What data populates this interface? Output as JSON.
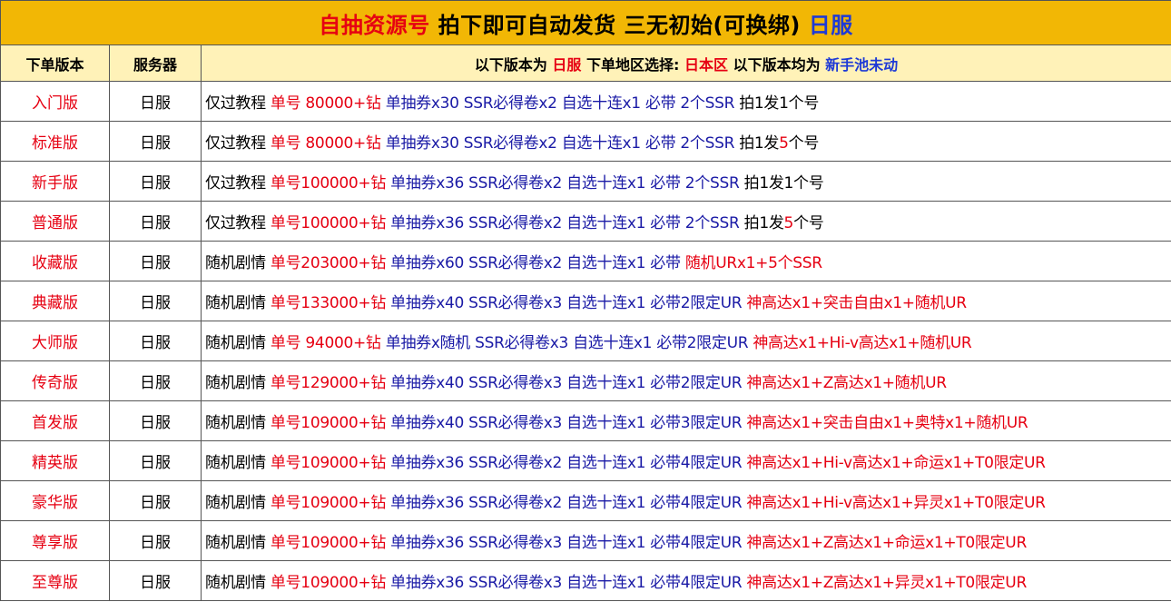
{
  "title": [
    {
      "text": "自抽资源号 ",
      "color": "r"
    },
    {
      "text": "拍下即可自动发货 三无初始(可换绑) ",
      "color": "k"
    },
    {
      "text": "日服",
      "color": "bb"
    }
  ],
  "header": {
    "col_version": "下单版本",
    "col_server": "服务器",
    "col_desc": [
      {
        "text": "以下版本为 ",
        "color": "k"
      },
      {
        "text": "日服",
        "color": "r"
      },
      {
        "text": " 下单地区选择: ",
        "color": "k"
      },
      {
        "text": "日本区",
        "color": "r"
      },
      {
        "text": " 以下版本均为 ",
        "color": "k"
      },
      {
        "text": "新手池未动",
        "color": "bb"
      }
    ]
  },
  "rows": [
    {
      "version": "入门版",
      "server": "日服",
      "desc": [
        {
          "text": "仅过教程 ",
          "color": "k"
        },
        {
          "text": "单号  80000+钻 ",
          "color": "r"
        },
        {
          "text": "单抽券x30  SSR必得卷x2  自选十连x1  必带 2个SSR ",
          "color": "b"
        },
        {
          "text": " 拍1发1个号",
          "color": "k"
        }
      ]
    },
    {
      "version": "标准版",
      "server": "日服",
      "desc": [
        {
          "text": "仅过教程 ",
          "color": "k"
        },
        {
          "text": "单号  80000+钻 ",
          "color": "r"
        },
        {
          "text": "单抽券x30  SSR必得卷x2  自选十连x1  必带 2个SSR ",
          "color": "b"
        },
        {
          "text": " 拍1发",
          "color": "k"
        },
        {
          "text": "5",
          "color": "r"
        },
        {
          "text": "个号",
          "color": "k"
        }
      ]
    },
    {
      "version": "新手版",
      "server": "日服",
      "desc": [
        {
          "text": "仅过教程 ",
          "color": "k"
        },
        {
          "text": "单号100000+钻 ",
          "color": "r"
        },
        {
          "text": "单抽券x36  SSR必得卷x2  自选十连x1  必带 2个SSR ",
          "color": "b"
        },
        {
          "text": " 拍1发1个号",
          "color": "k"
        }
      ]
    },
    {
      "version": "普通版",
      "server": "日服",
      "desc": [
        {
          "text": "仅过教程 ",
          "color": "k"
        },
        {
          "text": "单号100000+钻 ",
          "color": "r"
        },
        {
          "text": "单抽券x36  SSR必得卷x2  自选十连x1  必带 2个SSR ",
          "color": "b"
        },
        {
          "text": " 拍1发",
          "color": "k"
        },
        {
          "text": "5",
          "color": "r"
        },
        {
          "text": "个号",
          "color": "k"
        }
      ]
    },
    {
      "version": "收藏版",
      "server": "日服",
      "desc": [
        {
          "text": "随机剧情 ",
          "color": "k"
        },
        {
          "text": "单号203000+钻 ",
          "color": "r"
        },
        {
          "text": "单抽券x60  SSR必得卷x2  自选十连x1  必带 ",
          "color": "b"
        },
        {
          "text": "随机URx1+5个SSR",
          "color": "r"
        }
      ]
    },
    {
      "version": "典藏版",
      "server": "日服",
      "desc": [
        {
          "text": "随机剧情 ",
          "color": "k"
        },
        {
          "text": "单号133000+钻 ",
          "color": "r"
        },
        {
          "text": "单抽券x40  SSR必得卷x3  自选十连x1  必带2限定UR ",
          "color": "b"
        },
        {
          "text": "神高达x1+突击自由x1+随机UR",
          "color": "r"
        }
      ]
    },
    {
      "version": "大师版",
      "server": "日服",
      "desc": [
        {
          "text": "随机剧情 ",
          "color": "k"
        },
        {
          "text": "单号  94000+钻 ",
          "color": "r"
        },
        {
          "text": "单抽券x随机 SSR必得卷x3  自选十连x1  必带2限定UR ",
          "color": "b"
        },
        {
          "text": "神高达x1+Hi-v高达x1+随机UR",
          "color": "r"
        }
      ]
    },
    {
      "version": "传奇版",
      "server": "日服",
      "desc": [
        {
          "text": "随机剧情 ",
          "color": "k"
        },
        {
          "text": "单号129000+钻 ",
          "color": "r"
        },
        {
          "text": "单抽券x40 SSR必得卷x3  自选十连x1  必带2限定UR ",
          "color": "b"
        },
        {
          "text": "神高达x1+Z高达x1+随机UR",
          "color": "r"
        }
      ]
    },
    {
      "version": "首发版",
      "server": "日服",
      "desc": [
        {
          "text": "随机剧情 ",
          "color": "k"
        },
        {
          "text": "单号109000+钻 ",
          "color": "r"
        },
        {
          "text": "单抽券x40 SSR必得卷x3 自选十连x1  必带3限定UR ",
          "color": "b"
        },
        {
          "text": "神高达x1+突击自由x1+奥特x1+随机UR",
          "color": "r"
        }
      ]
    },
    {
      "version": "精英版",
      "server": "日服",
      "desc": [
        {
          "text": "随机剧情 ",
          "color": "k"
        },
        {
          "text": "单号109000+钻 ",
          "color": "r"
        },
        {
          "text": "单抽券x36 SSR必得卷x2 自选十连x1  必带4限定UR ",
          "color": "b"
        },
        {
          "text": "神高达x1+Hi-v高达x1+命运x1+T0限定UR",
          "color": "r"
        }
      ]
    },
    {
      "version": "豪华版",
      "server": "日服",
      "desc": [
        {
          "text": "随机剧情 ",
          "color": "k"
        },
        {
          "text": "单号109000+钻 ",
          "color": "r"
        },
        {
          "text": "单抽券x36 SSR必得卷x2 自选十连x1  必带4限定UR ",
          "color": "b"
        },
        {
          "text": "神高达x1+Hi-v高达x1+异灵x1+T0限定UR",
          "color": "r"
        }
      ]
    },
    {
      "version": "尊享版",
      "server": "日服",
      "desc": [
        {
          "text": "随机剧情 ",
          "color": "k"
        },
        {
          "text": "单号109000+钻 ",
          "color": "r"
        },
        {
          "text": "单抽券x36 SSR必得卷x3 自选十连x1  必带4限定UR ",
          "color": "b"
        },
        {
          "text": "神高达x1+Z高达x1+命运x1+T0限定UR",
          "color": "r"
        }
      ]
    },
    {
      "version": "至尊版",
      "server": "日服",
      "desc": [
        {
          "text": "随机剧情 ",
          "color": "k"
        },
        {
          "text": "单号109000+钻 ",
          "color": "r"
        },
        {
          "text": "单抽券x36 SSR必得卷x3 自选十连x1  必带4限定UR ",
          "color": "b"
        },
        {
          "text": "神高达x1+Z高达x1+异灵x1+T0限定UR",
          "color": "r"
        }
      ]
    }
  ]
}
